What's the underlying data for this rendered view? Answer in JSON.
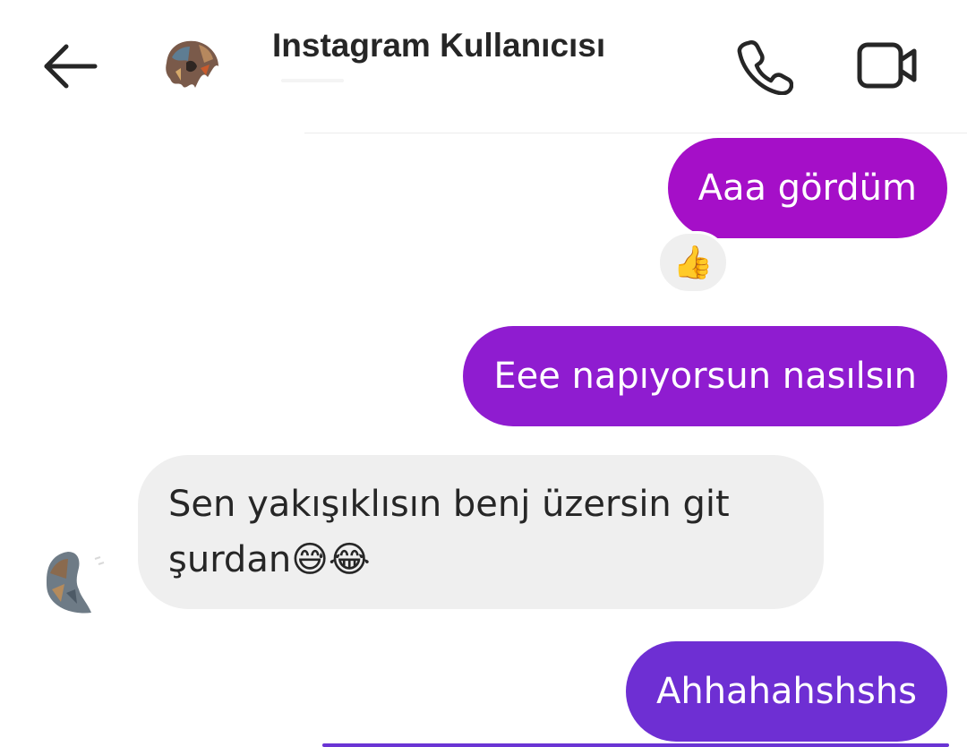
{
  "header": {
    "title": "Instagram Kullanıcısı",
    "back_icon": "arrow-left-icon",
    "call_icon": "phone-icon",
    "video_icon": "video-camera-icon"
  },
  "messages": [
    {
      "direction": "outgoing",
      "text": "Aaa gördüm",
      "reaction": "👍"
    },
    {
      "direction": "outgoing",
      "text": "Eee napıyorsun nasılsın"
    },
    {
      "direction": "incoming",
      "line1": "Sen yakışıklısın benj üzersin git",
      "line2": "şurdan",
      "emoji": "😅😂"
    },
    {
      "direction": "outgoing",
      "text": "Ahhahahshshs"
    }
  ],
  "colors": {
    "bubble_out_1": "#a50fc8",
    "bubble_out_2": "#8f1cd0",
    "bubble_out_3": "#6e2fd3",
    "bubble_in": "#efefef",
    "text_dark": "#262626"
  }
}
